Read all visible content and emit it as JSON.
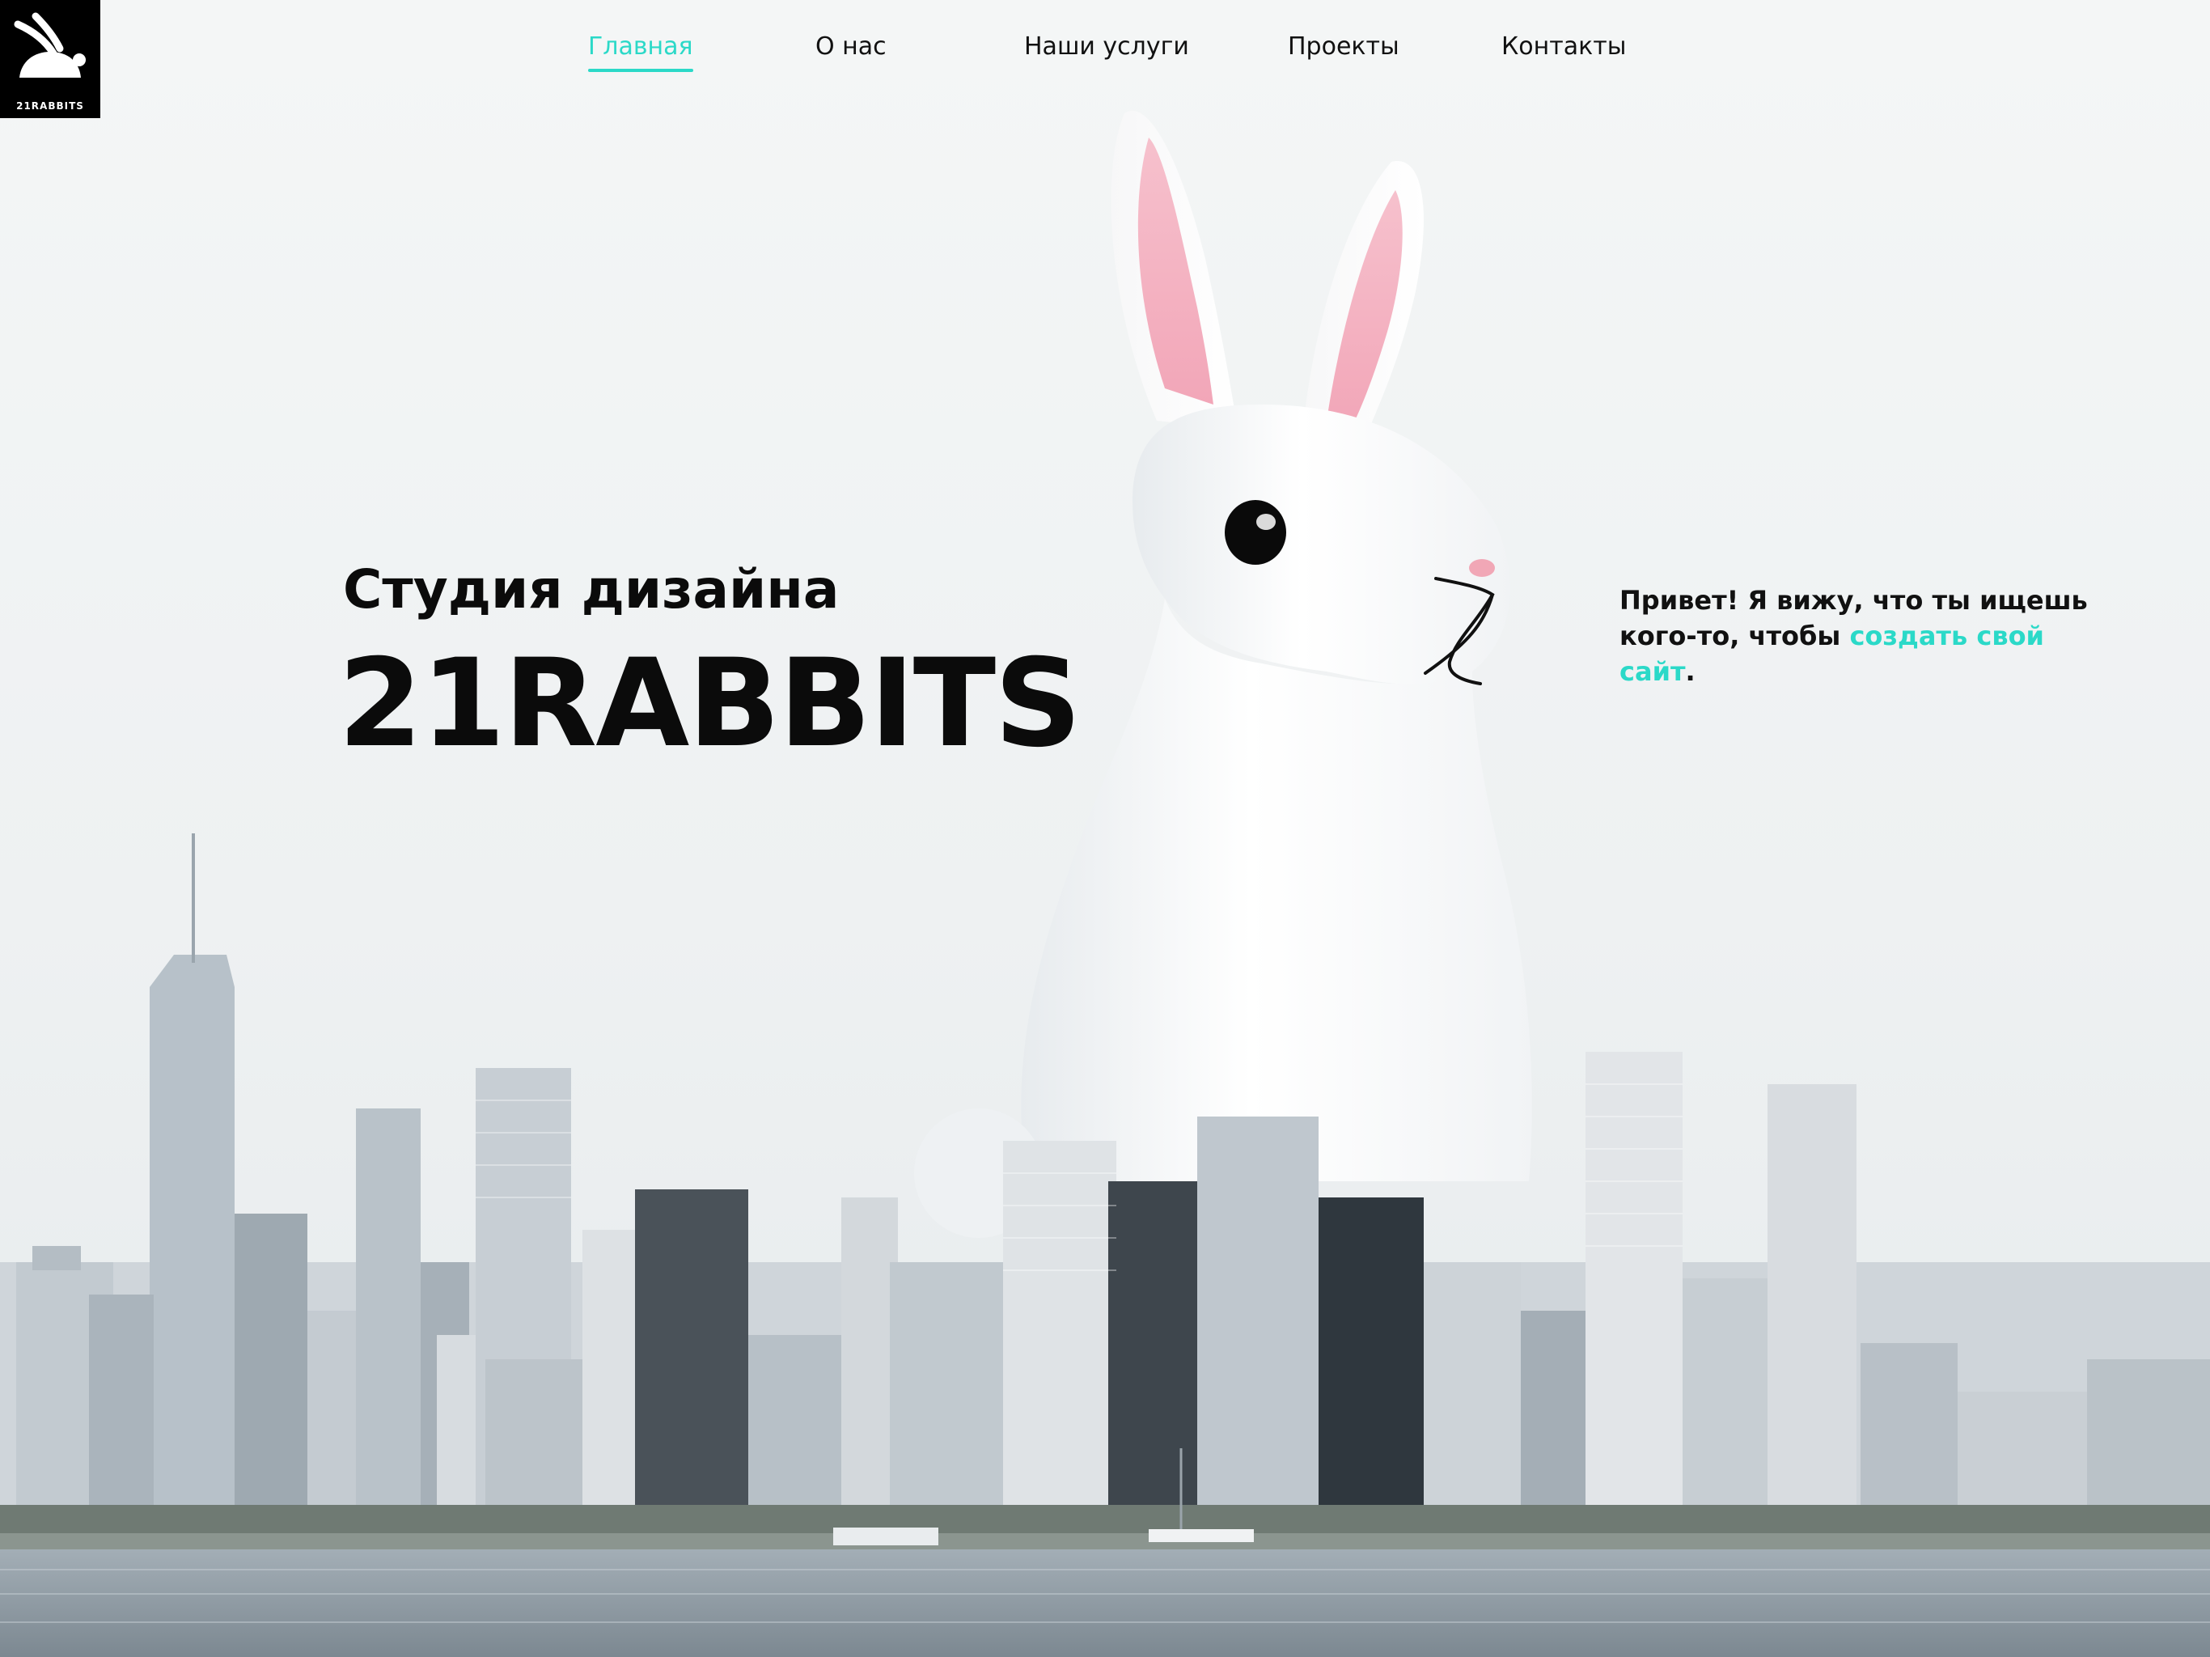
{
  "logo": {
    "text": "21RABBITS",
    "icon": "rabbit-logo-icon"
  },
  "nav": {
    "items": [
      {
        "label": "Главная",
        "active": true
      },
      {
        "label": "О нас",
        "active": false
      },
      {
        "label": "Наши услуги",
        "active": false
      },
      {
        "label": "Проекты",
        "active": false
      },
      {
        "label": "Контакты",
        "active": false
      }
    ]
  },
  "hero": {
    "subtitle": "Студия дизайна",
    "title": "21RABBITS",
    "greeting_before": "Привет! Я вижу, что ты ищешь кого-то, чтобы ",
    "greeting_link": "создать свой сайт",
    "greeting_after": "."
  },
  "colors": {
    "accent": "#2bd9c8",
    "text": "#111111",
    "logo_bg": "#000000"
  }
}
